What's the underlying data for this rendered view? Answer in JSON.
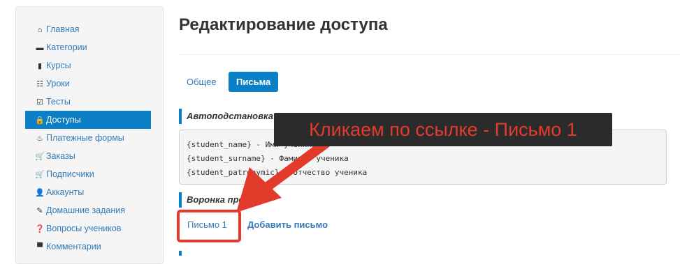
{
  "sidebar": {
    "items": [
      {
        "label": "Главная",
        "icon": "home-icon",
        "glyph": "⌂",
        "active": false
      },
      {
        "label": "Категории",
        "icon": "folder-icon",
        "glyph": "▬",
        "active": false
      },
      {
        "label": "Курсы",
        "icon": "book-icon",
        "glyph": "▮",
        "active": false
      },
      {
        "label": "Уроки",
        "icon": "list-icon",
        "glyph": "☷",
        "active": false
      },
      {
        "label": "Тесты",
        "icon": "check-square-icon",
        "glyph": "☑",
        "active": false
      },
      {
        "label": "Доступы",
        "icon": "lock-icon",
        "glyph": "🔒",
        "active": true
      },
      {
        "label": "Платежные формы",
        "icon": "fire-icon",
        "glyph": "♨",
        "active": false
      },
      {
        "label": "Заказы",
        "icon": "cart-icon",
        "glyph": "🛒",
        "active": false
      },
      {
        "label": "Подписчики",
        "icon": "cart-icon",
        "glyph": "🛒",
        "active": false
      },
      {
        "label": "Аккаунты",
        "icon": "user-icon",
        "glyph": "👤",
        "active": false
      },
      {
        "label": "Домашние задания",
        "icon": "pencil-icon",
        "glyph": "✎",
        "active": false
      },
      {
        "label": "Вопросы учеников",
        "icon": "question-icon",
        "glyph": "❓",
        "active": false
      },
      {
        "label": "Комментарии",
        "icon": "comment-icon",
        "glyph": "▀",
        "active": false
      }
    ]
  },
  "main": {
    "title": "Редактирование доступа",
    "tabs": [
      {
        "label": "Общее",
        "active": false
      },
      {
        "label": "Письма",
        "active": true
      }
    ],
    "autosubstitution": {
      "heading": "Автоподстановка",
      "lines": [
        "{student_name} - Имя ученика",
        "{student_surname} - Фамилия ученика",
        "{student_patronymic} - Отчество ученика"
      ]
    },
    "funnel": {
      "heading": "Воронка продаж",
      "letter_link": "Письмо 1",
      "add_link": "Добавить письмо"
    }
  },
  "annotation": {
    "callout_text": "Кликаем по ссылке - Письмо 1",
    "color": "#e33b2c"
  },
  "colors": {
    "accent": "#0a7fc6",
    "link": "#337ab7",
    "annotation_red": "#e23a2b"
  }
}
